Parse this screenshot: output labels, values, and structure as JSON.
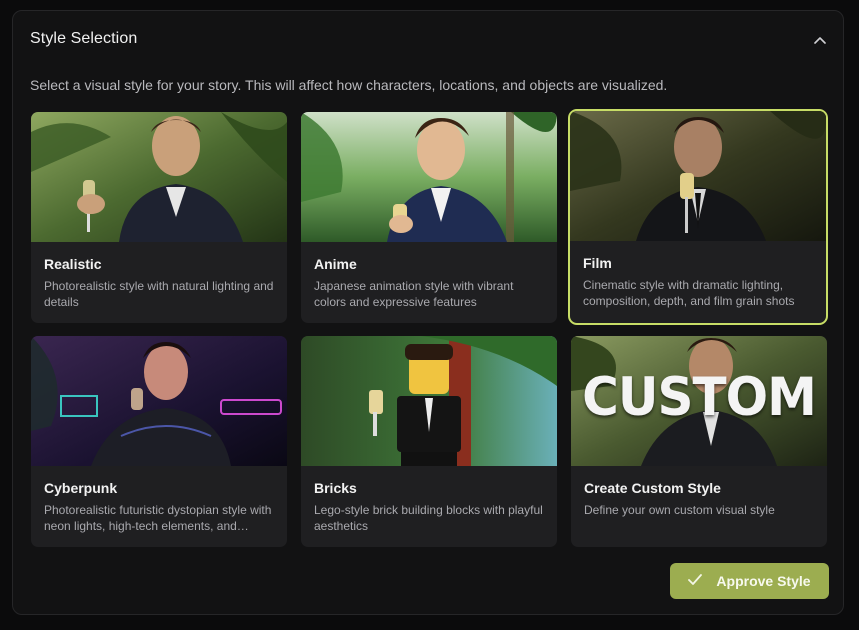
{
  "panel": {
    "title": "Style Selection",
    "collapse_icon": "chevron-up-icon",
    "description": "Select a visual style for your story. This will affect how characters, locations, and objects are visualized."
  },
  "styles": [
    {
      "id": "realistic",
      "title": "Realistic",
      "description": "Photorealistic style with natural lighting and details",
      "selected": false,
      "palette": [
        "#5f7a3a",
        "#2b3a1d",
        "#d8c39a"
      ]
    },
    {
      "id": "anime",
      "title": "Anime",
      "description": "Japanese animation style with vibrant colors and expressive features",
      "selected": false,
      "palette": [
        "#7ab06a",
        "#2f5a2a",
        "#e8d5b0"
      ]
    },
    {
      "id": "film",
      "title": "Film",
      "description": "Cinematic style with dramatic lighting, composition, depth, and film grain shots",
      "selected": true,
      "palette": [
        "#4a5030",
        "#1f2216",
        "#cbb89a"
      ]
    },
    {
      "id": "cyberpunk",
      "title": "Cyberpunk",
      "description": "Photorealistic futuristic dystopian style with neon lights, high-tech elements, and moody atmosphere",
      "selected": false,
      "palette": [
        "#2a1a3a",
        "#0d0a18",
        "#d94fd6"
      ]
    },
    {
      "id": "bricks",
      "title": "Bricks",
      "description": "Lego-style brick building blocks with playful aesthetics",
      "selected": false,
      "palette": [
        "#3e6a3a",
        "#1b2f1a",
        "#9a3a28"
      ]
    },
    {
      "id": "custom",
      "title": "Create Custom Style",
      "description": "Define your own custom visual style",
      "selected": false,
      "overlay_text": "CUSTOM",
      "palette": [
        "#4a5a30",
        "#1f2516",
        "#e0e0e0"
      ]
    }
  ],
  "footer": {
    "approve_label": "Approve Style",
    "approve_icon": "check-icon",
    "accent_color": "#9cad50",
    "selected_outline_color": "#c7dd66"
  }
}
